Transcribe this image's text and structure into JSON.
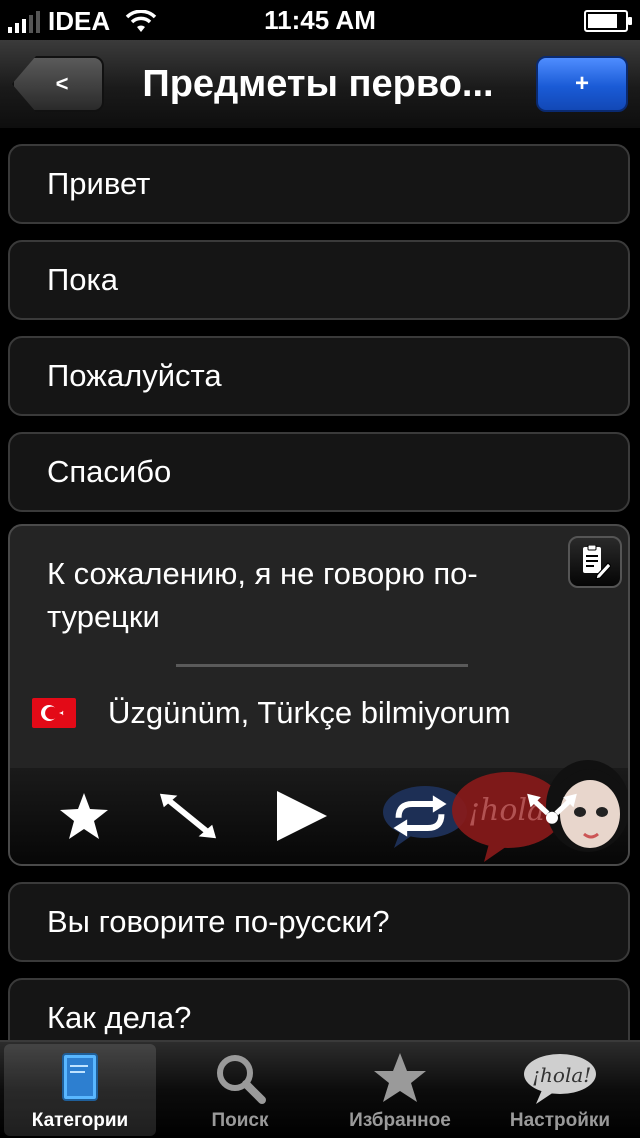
{
  "status_bar": {
    "carrier": "IDEA",
    "time": "11:45 AM",
    "signal_bars": 3,
    "battery_level": 0.9
  },
  "nav": {
    "back_label": "<",
    "title": "Предметы перво...",
    "add_label": "+"
  },
  "phrases": [
    {
      "text": "Привет"
    },
    {
      "text": "Пока"
    },
    {
      "text": "Пожалуйста"
    },
    {
      "text": "Спасибо"
    }
  ],
  "expanded": {
    "phrase": "К сожалению, я не говорю по-турецки",
    "translation": "Üzgünüm, Türkçe bilmiyorum",
    "flag": "turkey-flag",
    "decoration_text": "¡hola!",
    "actions": [
      {
        "icon": "star-icon"
      },
      {
        "icon": "expand-arrows-icon"
      },
      {
        "icon": "play-icon"
      },
      {
        "icon": "repeat-icon"
      },
      {
        "icon": "share-arrows-icon"
      }
    ]
  },
  "more_phrases": [
    {
      "text": "Вы говорите по-русски?"
    },
    {
      "text": "Как дела?"
    }
  ],
  "tabs": [
    {
      "label": "Категории",
      "icon": "book-icon",
      "active": true
    },
    {
      "label": "Поиск",
      "icon": "search-icon",
      "active": false
    },
    {
      "label": "Избранное",
      "icon": "star-icon",
      "active": false
    },
    {
      "label": "Настройки",
      "icon": "hola-bubble-icon",
      "active": false
    }
  ],
  "colors": {
    "accent": "#1a5bd6",
    "flag_red": "#e30a17"
  }
}
